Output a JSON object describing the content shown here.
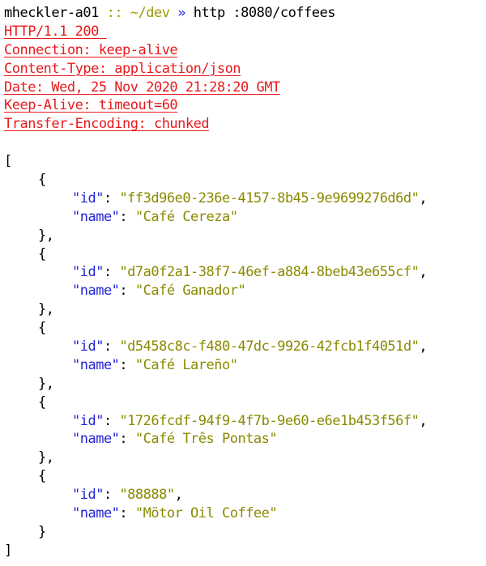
{
  "prompt": {
    "host": "mheckler-a01",
    "separator": "::",
    "cwd": "~/dev",
    "arrow": "»",
    "command": "http :8080/coffees"
  },
  "response_headers": [
    "HTTP/1.1 200 ",
    "Connection: keep-alive",
    "Content-Type: application/json",
    "Date: Wed, 25 Nov 2020 21:28:20 GMT",
    "Keep-Alive: timeout=60",
    "Transfer-Encoding: chunked"
  ],
  "json_syntax": {
    "open_array": "[",
    "close_array": "]",
    "open_object": "{",
    "close_object": "}",
    "close_object_comma": "},",
    "colon": ": ",
    "comma": ","
  },
  "json_keys": {
    "id": "\"id\"",
    "name": "\"name\""
  },
  "coffees": [
    {
      "id": "\"ff3d96e0-236e-4157-8b45-9e9699276d6d\"",
      "name": "\"Café Cereza\""
    },
    {
      "id": "\"d7a0f2a1-38f7-46ef-a884-8beb43e655cf\"",
      "name": "\"Café Ganador\""
    },
    {
      "id": "\"d5458c8c-f480-47dc-9926-42fcb1f4051d\"",
      "name": "\"Café Lareño\""
    },
    {
      "id": "\"1726fcdf-94f9-4f7b-9e60-e6e1b453f56f\"",
      "name": "\"Café Três Pontas\""
    },
    {
      "id": "\"88888\"",
      "name": "\"Mötor Oil Coffee\""
    }
  ],
  "colors": {
    "header": "#e8191c",
    "key": "#2323d8",
    "string": "#8a8a00",
    "background": "#ffffff"
  }
}
